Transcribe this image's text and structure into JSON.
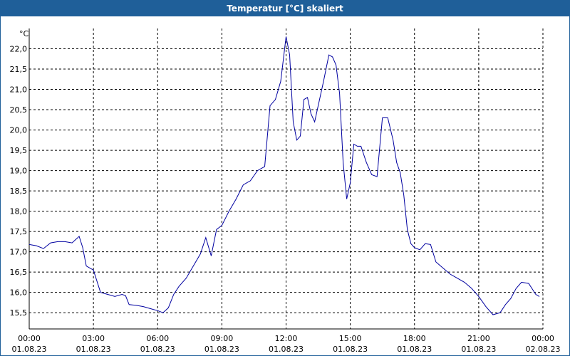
{
  "window": {
    "title": "Temperatur [°C] skaliert"
  },
  "colors": {
    "title_bar": "#1f5f99",
    "series_line": "#0000a0",
    "grid": "#000000"
  },
  "chart_data": {
    "type": "line",
    "title": "Temperatur [°C] skaliert",
    "ylabel": "°C",
    "xlabel": "",
    "ylim": [
      15.1,
      22.5
    ],
    "xlim": [
      "01.08.23 00:00",
      "02.08.23 00:00"
    ],
    "grid": true,
    "grid_style": "dashed",
    "y_ticks": [
      "22,0",
      "21,5",
      "21,0",
      "20,5",
      "20,0",
      "19,5",
      "19,0",
      "18,5",
      "18,0",
      "17,5",
      "17,0",
      "16,5",
      "16,0",
      "15,5"
    ],
    "y_tick_values": [
      22.0,
      21.5,
      21.0,
      20.5,
      20.0,
      19.5,
      19.0,
      18.5,
      18.0,
      17.5,
      17.0,
      16.5,
      16.0,
      15.5
    ],
    "x_ticks": [
      {
        "time": "00:00",
        "date": "01.08.23"
      },
      {
        "time": "03:00",
        "date": "01.08.23"
      },
      {
        "time": "06:00",
        "date": "01.08.23"
      },
      {
        "time": "09:00",
        "date": "01.08.23"
      },
      {
        "time": "12:00",
        "date": "01.08.23"
      },
      {
        "time": "15:00",
        "date": "01.08.23"
      },
      {
        "time": "18:00",
        "date": "01.08.23"
      },
      {
        "time": "21:00",
        "date": "01.08.23"
      },
      {
        "time": "00:00",
        "date": "02.08.23"
      }
    ],
    "x_tick_hours": [
      0,
      3,
      6,
      9,
      12,
      15,
      18,
      21,
      24
    ],
    "series": [
      {
        "x": [
          "01.08.23 00:00",
          "01.08.23 00:20",
          "01.08.23 00:40",
          "01.08.23 01:00",
          "01.08.23 01:20",
          "01.08.23 01:40",
          "01.08.23 02:00",
          "01.08.23 02:20",
          "01.08.23 02:30",
          "01.08.23 02:40",
          "01.08.23 03:00",
          "01.08.23 03:20",
          "01.08.23 03:40",
          "01.08.23 04:00",
          "01.08.23 04:20",
          "01.08.23 04:30",
          "01.08.23 04:40",
          "01.08.23 05:00",
          "01.08.23 05:20",
          "01.08.23 05:40",
          "01.08.23 06:00",
          "01.08.23 06:15",
          "01.08.23 06:30",
          "01.08.23 06:45",
          "01.08.23 07:00",
          "01.08.23 07:20",
          "01.08.23 07:40",
          "01.08.23 08:00",
          "01.08.23 08:15",
          "01.08.23 08:30",
          "01.08.23 08:45",
          "01.08.23 09:00",
          "01.08.23 09:20",
          "01.08.23 09:40",
          "01.08.23 10:00",
          "01.08.23 10:20",
          "01.08.23 10:40",
          "01.08.23 11:00",
          "01.08.23 11:15",
          "01.08.23 11:30",
          "01.08.23 11:45",
          "01.08.23 12:00",
          "01.08.23 12:10",
          "01.08.23 12:20",
          "01.08.23 12:30",
          "01.08.23 12:40",
          "01.08.23 12:50",
          "01.08.23 13:00",
          "01.08.23 13:10",
          "01.08.23 13:20",
          "01.08.23 13:30",
          "01.08.23 13:45",
          "01.08.23 14:00",
          "01.08.23 14:10",
          "01.08.23 14:20",
          "01.08.23 14:30",
          "01.08.23 14:40",
          "01.08.23 14:50",
          "01.08.23 15:00",
          "01.08.23 15:10",
          "01.08.23 15:20",
          "01.08.23 15:30",
          "01.08.23 15:45",
          "01.08.23 16:00",
          "01.08.23 16:15",
          "01.08.23 16:30",
          "01.08.23 16:45",
          "01.08.23 17:00",
          "01.08.23 17:10",
          "01.08.23 17:20",
          "01.08.23 17:30",
          "01.08.23 17:40",
          "01.08.23 17:50",
          "01.08.23 18:00",
          "01.08.23 18:15",
          "01.08.23 18:30",
          "01.08.23 18:45",
          "01.08.23 19:00",
          "01.08.23 19:20",
          "01.08.23 19:40",
          "01.08.23 20:00",
          "01.08.23 20:20",
          "01.08.23 20:40",
          "01.08.23 21:00",
          "01.08.23 21:20",
          "01.08.23 21:40",
          "01.08.23 22:00",
          "01.08.23 22:15",
          "01.08.23 22:30",
          "01.08.23 22:45",
          "01.08.23 23:00",
          "01.08.23 23:20",
          "01.08.23 23:40",
          "01.08.23 23:50"
        ],
        "values": [
          17.18,
          17.15,
          17.08,
          17.22,
          17.25,
          17.25,
          17.22,
          17.38,
          17.1,
          16.65,
          16.55,
          16.0,
          15.95,
          15.9,
          15.95,
          15.92,
          15.7,
          15.68,
          15.65,
          15.6,
          15.55,
          15.5,
          15.62,
          15.95,
          16.15,
          16.35,
          16.65,
          16.95,
          17.35,
          16.9,
          17.55,
          17.65,
          18.0,
          18.3,
          18.65,
          18.75,
          19.0,
          19.1,
          20.6,
          20.75,
          21.2,
          22.3,
          21.85,
          20.2,
          19.75,
          19.85,
          20.75,
          20.8,
          20.4,
          20.2,
          20.6,
          21.2,
          21.85,
          21.8,
          21.6,
          20.9,
          19.2,
          18.3,
          18.7,
          19.65,
          19.6,
          19.6,
          19.2,
          18.9,
          18.85,
          20.3,
          20.3,
          19.75,
          19.2,
          18.95,
          18.4,
          17.55,
          17.2,
          17.1,
          17.05,
          17.2,
          17.18,
          16.75,
          16.6,
          16.45,
          16.35,
          16.25,
          16.1,
          15.9,
          15.65,
          15.45,
          15.5,
          15.7,
          15.85,
          16.1,
          16.25,
          16.22,
          15.95,
          15.9
        ]
      }
    ]
  }
}
